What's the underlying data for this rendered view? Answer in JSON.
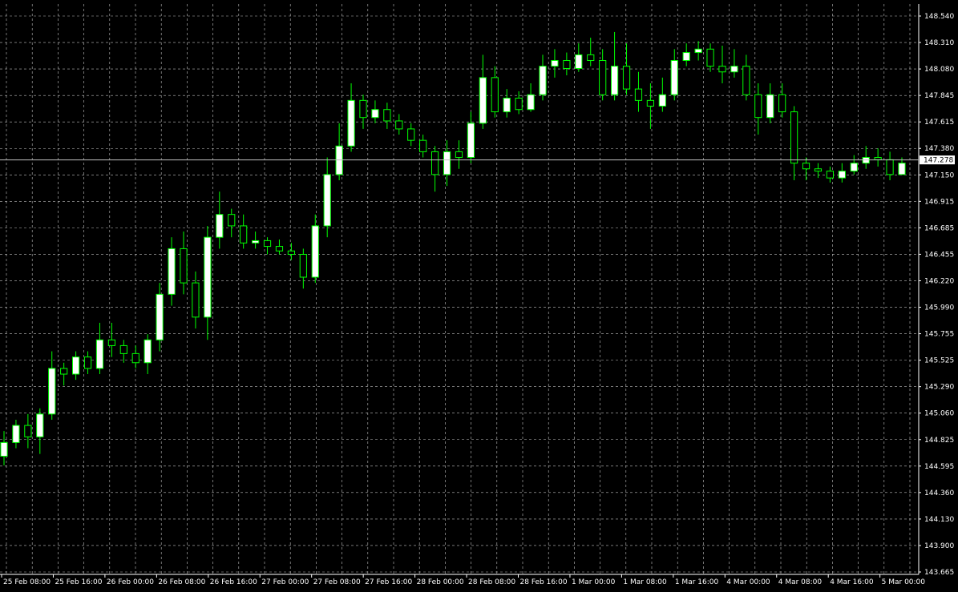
{
  "colors": {
    "background": "#000000",
    "grid": "#c0c0c0",
    "axis": "#ffffff",
    "bull_candle": "#ffffff",
    "wick": "#00ff00",
    "bear_candle": "#000000",
    "price_line": "#c0c0c0",
    "price_label_bg": "#ffffff",
    "text": "#ffffff"
  },
  "chart_data": {
    "type": "candlestick",
    "title": "",
    "xlabel": "",
    "ylabel": "",
    "ylim": [
      143.665,
      148.54
    ],
    "grid": true,
    "current_price": "147.278",
    "y_ticks": [
      "148.540",
      "148.310",
      "148.080",
      "147.845",
      "147.615",
      "147.380",
      "147.150",
      "146.915",
      "146.685",
      "146.455",
      "146.220",
      "145.990",
      "145.755",
      "145.525",
      "145.290",
      "145.060",
      "144.825",
      "144.595",
      "144.360",
      "144.130",
      "143.900",
      "143.665"
    ],
    "x_ticks": [
      "25 Feb 08:00",
      "25 Feb 16:00",
      "26 Feb 00:00",
      "26 Feb 08:00",
      "26 Feb 16:00",
      "27 Feb 00:00",
      "27 Feb 08:00",
      "27 Feb 16:00",
      "28 Feb 00:00",
      "28 Feb 08:00",
      "28 Feb 16:00",
      "1 Mar 00:00",
      "1 Mar 08:00",
      "1 Mar 16:00",
      "4 Mar 00:00",
      "4 Mar 08:00",
      "4 Mar 16:00",
      "5 Mar 00:00"
    ],
    "candles": [
      [
        144.68,
        144.8,
        144.6,
        144.9
      ],
      [
        144.8,
        144.95,
        144.75,
        145.0
      ],
      [
        144.95,
        144.85,
        144.75,
        145.05
      ],
      [
        144.85,
        145.05,
        144.7,
        145.1
      ],
      [
        145.05,
        145.45,
        145.0,
        145.6
      ],
      [
        145.45,
        145.4,
        145.3,
        145.5
      ],
      [
        145.4,
        145.55,
        145.35,
        145.6
      ],
      [
        145.55,
        145.45,
        145.4,
        145.6
      ],
      [
        145.45,
        145.7,
        145.4,
        145.85
      ],
      [
        145.7,
        145.65,
        145.55,
        145.85
      ],
      [
        145.65,
        145.58,
        145.5,
        145.7
      ],
      [
        145.58,
        145.5,
        145.45,
        145.65
      ],
      [
        145.5,
        145.7,
        145.4,
        145.75
      ],
      [
        145.7,
        146.1,
        145.6,
        146.2
      ],
      [
        146.1,
        146.5,
        146.0,
        146.6
      ],
      [
        146.5,
        146.2,
        146.1,
        146.65
      ],
      [
        146.2,
        145.9,
        145.8,
        146.3
      ],
      [
        145.9,
        146.6,
        145.7,
        146.7
      ],
      [
        146.6,
        146.8,
        146.5,
        147.0
      ],
      [
        146.8,
        146.7,
        146.6,
        146.85
      ],
      [
        146.7,
        146.55,
        146.5,
        146.8
      ],
      [
        146.55,
        146.57,
        146.5,
        146.65
      ],
      [
        146.57,
        146.52,
        146.45,
        146.6
      ],
      [
        146.52,
        146.48,
        146.45,
        146.58
      ],
      [
        146.48,
        146.45,
        146.4,
        146.55
      ],
      [
        146.45,
        146.25,
        146.15,
        146.5
      ],
      [
        146.25,
        146.7,
        146.2,
        146.8
      ],
      [
        146.7,
        147.15,
        146.6,
        147.3
      ],
      [
        147.15,
        147.4,
        147.1,
        147.6
      ],
      [
        147.4,
        147.8,
        147.35,
        147.95
      ],
      [
        147.8,
        147.65,
        147.55,
        147.85
      ],
      [
        147.65,
        147.72,
        147.6,
        147.8
      ],
      [
        147.72,
        147.62,
        147.55,
        147.78
      ],
      [
        147.62,
        147.55,
        147.5,
        147.68
      ],
      [
        147.55,
        147.45,
        147.4,
        147.6
      ],
      [
        147.45,
        147.35,
        147.3,
        147.5
      ],
      [
        147.35,
        147.15,
        147.0,
        147.4
      ],
      [
        147.15,
        147.35,
        147.05,
        147.45
      ],
      [
        147.35,
        147.3,
        147.2,
        147.45
      ],
      [
        147.3,
        147.6,
        147.25,
        147.7
      ],
      [
        147.6,
        148.0,
        147.55,
        148.2
      ],
      [
        148.0,
        147.7,
        147.65,
        148.1
      ],
      [
        147.7,
        147.82,
        147.65,
        147.9
      ],
      [
        147.82,
        147.72,
        147.68,
        147.88
      ],
      [
        147.72,
        147.85,
        147.7,
        147.95
      ],
      [
        147.85,
        148.1,
        147.8,
        148.2
      ],
      [
        148.1,
        148.15,
        148.0,
        148.25
      ],
      [
        148.15,
        148.08,
        148.02,
        148.22
      ],
      [
        148.08,
        148.2,
        148.05,
        148.3
      ],
      [
        148.2,
        148.15,
        148.1,
        148.35
      ],
      [
        148.15,
        147.85,
        147.8,
        148.25
      ],
      [
        147.85,
        148.1,
        147.8,
        148.4
      ],
      [
        148.1,
        147.9,
        147.85,
        148.3
      ],
      [
        147.9,
        147.8,
        147.7,
        148.05
      ],
      [
        147.8,
        147.75,
        147.55,
        147.95
      ],
      [
        147.75,
        147.85,
        147.7,
        148.0
      ],
      [
        147.85,
        148.15,
        147.8,
        148.25
      ],
      [
        148.15,
        148.22,
        148.1,
        148.3
      ],
      [
        148.22,
        148.25,
        148.15,
        148.32
      ],
      [
        148.25,
        148.1,
        148.05,
        148.3
      ],
      [
        148.1,
        148.05,
        147.95,
        148.28
      ],
      [
        148.05,
        148.1,
        148.0,
        148.25
      ],
      [
        148.1,
        147.85,
        147.8,
        148.2
      ],
      [
        147.85,
        147.65,
        147.5,
        147.95
      ],
      [
        147.65,
        147.85,
        147.6,
        147.95
      ],
      [
        147.85,
        147.7,
        147.65,
        147.95
      ],
      [
        147.7,
        147.25,
        147.1,
        147.75
      ],
      [
        147.25,
        147.2,
        147.1,
        147.3
      ],
      [
        147.2,
        147.18,
        147.12,
        147.25
      ],
      [
        147.18,
        147.12,
        147.08,
        147.22
      ],
      [
        147.12,
        147.18,
        147.08,
        147.25
      ],
      [
        147.18,
        147.25,
        147.15,
        147.32
      ],
      [
        147.25,
        147.3,
        147.2,
        147.4
      ],
      [
        147.3,
        147.28,
        147.22,
        147.38
      ],
      [
        147.28,
        147.15,
        147.1,
        147.35
      ],
      [
        147.15,
        147.25,
        147.15,
        147.3
      ]
    ]
  }
}
